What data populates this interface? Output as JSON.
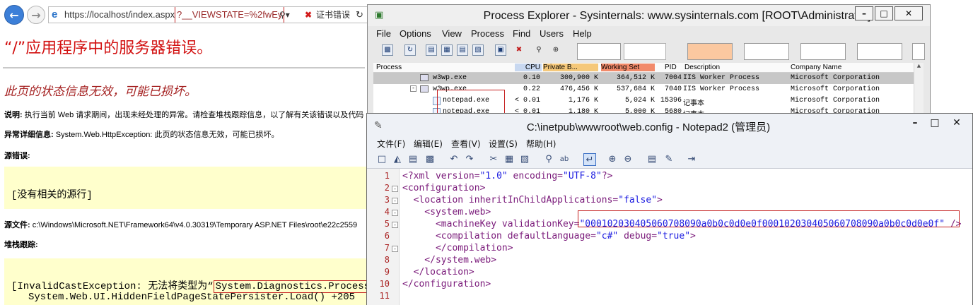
{
  "browser": {
    "url_base": "https://localhost/index.aspx",
    "url_param": "?__VIEWSTATE=%2fwEy",
    "cert_error": "证书错误",
    "error_title": "“/”应用程序中的服务器错误。",
    "error_subtitle": "此页的状态信息无效，可能已损坏。",
    "desc_label": "说明:",
    "desc_text": "执行当前 Web 请求期间，出现未经处理的异常。请检查堆栈跟踪信息，以了解有关该错误以及代码",
    "exc_label": "异常详细信息:",
    "exc_text": "System.Web.HttpException: 此页的状态信息无效，可能已损坏。",
    "src_err_label": "源错误:",
    "src_err_text": "[没有相关的源行]",
    "src_file_label": "源文件:",
    "src_file_text": "c:\\Windows\\Microsoft.NET\\Framework64\\v4.0.30319\\Temporary ASP.NET Files\\root\\e22c2559",
    "stack_label": "堆栈跟踪:",
    "stack_line1_pre": "[InvalidCastException: 无法将类型为“",
    "stack_line1_type": "System.Diagnostics.Process",
    "stack_line1_post": "”",
    "stack_line2": "System.Web.UI.HiddenFieldPageStatePersister.Load() +205"
  },
  "procexp": {
    "title": "Process Explorer - Sysinternals: www.sysinternals.com [ROOT\\Administrator]",
    "menu": [
      "File",
      "Options",
      "View",
      "Process",
      "Find",
      "Users",
      "Help"
    ],
    "columns": [
      "Process",
      "CPU",
      "Private B...",
      "Working Set",
      "PID",
      "Description",
      "Company Name"
    ],
    "rows": [
      {
        "name": "w3wp.exe",
        "cpu": "0.10",
        "private": "300,900 K",
        "working": "364,512 K",
        "pid": "7004",
        "desc": "IIS Worker Process",
        "company": "Microsoft Corporation"
      },
      {
        "name": "w3wp.exe",
        "cpu": "0.22",
        "private": "476,456 K",
        "working": "537,684 K",
        "pid": "7040",
        "desc": "IIS Worker Process",
        "company": "Microsoft Corporation"
      },
      {
        "name": "notepad.exe",
        "cpu": "< 0.01",
        "private": "1,176 K",
        "working": "5,024 K",
        "pid": "15396",
        "desc": "记事本",
        "company": "Microsoft Corporation"
      },
      {
        "name": "notepad.exe",
        "cpu": "< 0.01",
        "private": "1,180 K",
        "working": "5,000 K",
        "pid": "5680",
        "desc": "记事本",
        "company": "Microsoft Corporation"
      }
    ],
    "colors": {
      "cpu_header": "#c8d8f0",
      "private_header": "#f5c87a",
      "working_header": "#f28a6a",
      "selected_row": "#c7c7c7"
    }
  },
  "notepad": {
    "title": "C:\\inetpub\\wwwroot\\web.config - Notepad2 (管理员)",
    "menu": [
      "文件(F)",
      "编辑(E)",
      "查看(V)",
      "设置(S)",
      "帮助(H)"
    ],
    "lines": [
      {
        "n": "1",
        "seg": [
          {
            "c": "pi",
            "t": "<?xml "
          },
          {
            "c": "attr",
            "t": "version="
          },
          {
            "c": "val",
            "t": "\"1.0\""
          },
          {
            "c": "attr",
            "t": " encoding="
          },
          {
            "c": "val",
            "t": "\"UTF-8\""
          },
          {
            "c": "pi",
            "t": "?>"
          }
        ]
      },
      {
        "n": "2",
        "seg": [
          {
            "c": "tag",
            "t": "<configuration>"
          }
        ]
      },
      {
        "n": "3",
        "seg": [
          {
            "c": "tag",
            "t": "  <location "
          },
          {
            "c": "attr",
            "t": "inheritInChildApplications="
          },
          {
            "c": "val",
            "t": "\"false\""
          },
          {
            "c": "tag",
            "t": ">"
          }
        ]
      },
      {
        "n": "4",
        "seg": [
          {
            "c": "tag",
            "t": "    <system.web>"
          }
        ]
      },
      {
        "n": "5",
        "seg": [
          {
            "c": "tag",
            "t": "      <machineKey "
          },
          {
            "c": "attr",
            "t": "validationKey="
          },
          {
            "c": "val",
            "t": "\"000102030405060708090a0b0c0d0e0f000102030405060708090a0b0c0d0e0f\""
          },
          {
            "c": "tag",
            "t": " />"
          }
        ]
      },
      {
        "n": "6",
        "seg": [
          {
            "c": "tag",
            "t": "      <compilation "
          },
          {
            "c": "attr",
            "t": "defaultLanguage="
          },
          {
            "c": "val",
            "t": "\"c#\""
          },
          {
            "c": "attr",
            "t": " debug="
          },
          {
            "c": "val",
            "t": "\"true\""
          },
          {
            "c": "tag",
            "t": ">"
          }
        ]
      },
      {
        "n": "7",
        "seg": [
          {
            "c": "tag",
            "t": "      </compilation>"
          }
        ]
      },
      {
        "n": "8",
        "seg": [
          {
            "c": "tag",
            "t": "    </system.web>"
          }
        ]
      },
      {
        "n": "9",
        "seg": [
          {
            "c": "tag",
            "t": "  </location>"
          }
        ]
      },
      {
        "n": "10",
        "seg": [
          {
            "c": "tag",
            "t": "</configuration>"
          }
        ]
      },
      {
        "n": "11",
        "seg": []
      }
    ]
  }
}
